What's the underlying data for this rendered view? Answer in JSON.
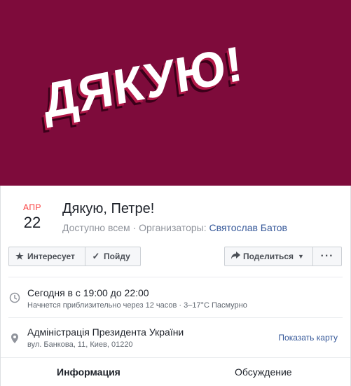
{
  "cover": {
    "text": "ДЯКУЮ!",
    "background": "#7e0b3b"
  },
  "event": {
    "month": "АПР",
    "day": "22",
    "title": "Дякую, Петре!",
    "visibility": "Доступно всем",
    "organizers_label": "· Организаторы:",
    "organizer": "Святослав Батов"
  },
  "actions": {
    "interested": "Интересует",
    "going": "Пойду",
    "share": "Поделиться",
    "more": "···"
  },
  "details": {
    "time_main": "Сегодня в с 19:00 до 22:00",
    "time_sub": "Начнется приблизительно через 12 часов · 3–17°C Пасмурно",
    "place_name": "Адміністрація Президента України",
    "place_address": "вул. Банкова, 11, Киев, 01220",
    "map_link": "Показать карту"
  },
  "tabs": {
    "info": "Информация",
    "discussion": "Обсуждение"
  },
  "icons": {
    "interested": "star-icon",
    "going": "checkmark-icon",
    "share": "share-arrow-icon",
    "time": "clock-icon",
    "place": "location-pin-icon"
  },
  "colors": {
    "accent_link": "#365899",
    "month_red": "#fa3e3e",
    "cover_bg": "#7e0b3b"
  }
}
